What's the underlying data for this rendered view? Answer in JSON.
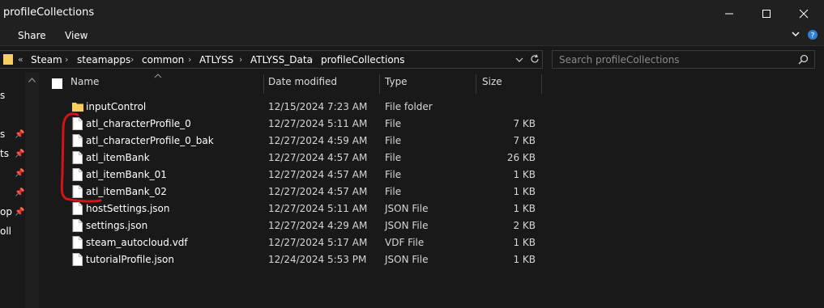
{
  "window": {
    "title": "profileCollections"
  },
  "ribbon": {
    "share": "Share",
    "view": "View"
  },
  "address": {
    "prefix": "«",
    "crumbs": [
      "Steam",
      "steamapps",
      "common",
      "ATLYSS",
      "ATLYSS_Data",
      "profileCollections"
    ]
  },
  "search": {
    "placeholder": "Search profileCollections"
  },
  "nav_fragments": [
    "s",
    "s",
    "ts",
    "",
    "",
    "op",
    "oll"
  ],
  "columns": {
    "name": "Name",
    "date": "Date modified",
    "type": "Type",
    "size": "Size"
  },
  "files": [
    {
      "name": "inputControl",
      "date": "12/15/2024 7:23 AM",
      "type": "File folder",
      "size": "",
      "icon": "folder-icon"
    },
    {
      "name": "atl_characterProfile_0",
      "date": "12/27/2024 5:11 AM",
      "type": "File",
      "size": "7 KB",
      "icon": "file-icon"
    },
    {
      "name": "atl_characterProfile_0_bak",
      "date": "12/27/2024 4:59 AM",
      "type": "File",
      "size": "7 KB",
      "icon": "file-icon"
    },
    {
      "name": "atl_itemBank",
      "date": "12/27/2024 4:57 AM",
      "type": "File",
      "size": "26 KB",
      "icon": "file-icon"
    },
    {
      "name": "atl_itemBank_01",
      "date": "12/27/2024 4:57 AM",
      "type": "File",
      "size": "1 KB",
      "icon": "file-icon"
    },
    {
      "name": "atl_itemBank_02",
      "date": "12/27/2024 4:57 AM",
      "type": "File",
      "size": "1 KB",
      "icon": "file-icon"
    },
    {
      "name": "hostSettings.json",
      "date": "12/27/2024 5:11 AM",
      "type": "JSON File",
      "size": "1 KB",
      "icon": "file-icon"
    },
    {
      "name": "settings.json",
      "date": "12/27/2024 4:29 AM",
      "type": "JSON File",
      "size": "2 KB",
      "icon": "file-icon"
    },
    {
      "name": "steam_autocloud.vdf",
      "date": "12/27/2024 5:17 AM",
      "type": "VDF File",
      "size": "1 KB",
      "icon": "file-icon"
    },
    {
      "name": "tutorialProfile.json",
      "date": "12/24/2024 5:53 PM",
      "type": "JSON File",
      "size": "1 KB",
      "icon": "file-icon"
    }
  ],
  "colors": {
    "background": "#191919",
    "chrome": "#202020",
    "folder": "#f6cf5f",
    "annotation": "#d4121a"
  }
}
